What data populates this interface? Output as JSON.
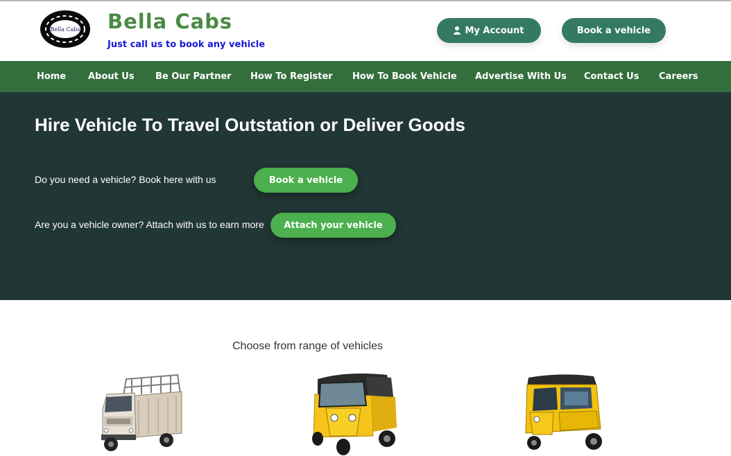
{
  "header": {
    "logo_text": "Bella Cabs",
    "brand_name": "Bella Cabs",
    "tagline": "Just call us to book any vehicle",
    "account_label": "My Account",
    "book_label": "Book a vehicle"
  },
  "nav": {
    "items": [
      {
        "label": "Home"
      },
      {
        "label": "About Us"
      },
      {
        "label": "Be Our Partner"
      },
      {
        "label": "How To Register"
      },
      {
        "label": "How To Book Vehicle"
      },
      {
        "label": "Advertise With Us"
      },
      {
        "label": "Contact Us"
      },
      {
        "label": "Careers"
      }
    ]
  },
  "hero": {
    "title": "Hire Vehicle To Travel Outstation or Deliver Goods",
    "line1_text": "Do you need a vehicle? Book here with us",
    "line1_button": "Book a vehicle",
    "line2_text": "Are you a vehicle owner? Attach with us to earn more",
    "line2_button": "Attach your vehicle"
  },
  "vehicles": {
    "title": "Choose from range of vehicles",
    "items": [
      {
        "icon": "mini-truck-icon"
      },
      {
        "icon": "auto-rickshaw-cargo-icon"
      },
      {
        "icon": "auto-rickshaw-passenger-icon"
      }
    ]
  },
  "colors": {
    "brand_green": "#4a8a46",
    "header_button": "#347a63",
    "nav_bg": "#346e3d",
    "hero_bg": "#213735",
    "hero_button": "#4bb04d",
    "tagline": "#1717d6"
  }
}
